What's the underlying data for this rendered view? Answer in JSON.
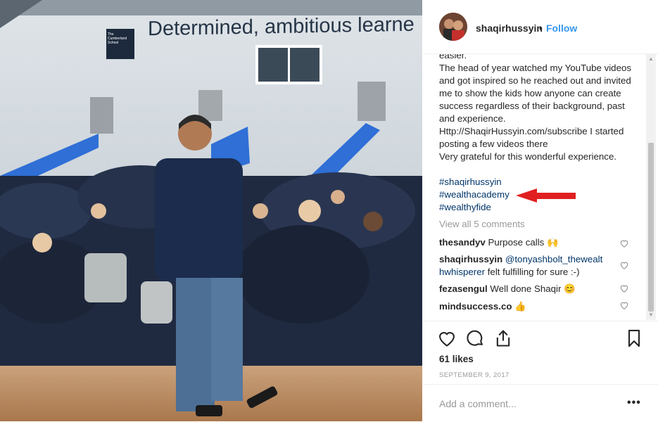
{
  "post": {
    "username": "shaqirhussyin",
    "separator": "•",
    "follow_label": "Follow",
    "photo": {
      "banner_text": "Determined, ambitious learne",
      "school_logo_text": "The Cumberland School"
    },
    "caption": "easier.\nThe head of year watched my YouTube videos and got inspired so he reached out and invited me to show the kids how anyone can create success regardless of their background, past and experience.\nHttp://ShaqirHussyin.com/subscribe I started posting a few videos there\nVery grateful for this wonderful experience.",
    "hashtags": [
      "#shaqirhussyin",
      "#wealthacademy",
      "#wealthyfide"
    ],
    "annotation_arrow_color": "#e02020",
    "view_all_comments": "View all 5 comments",
    "comments": [
      {
        "user": "thesandyv",
        "text": "Purpose calls 🙌"
      },
      {
        "user": "shaqirhussyin",
        "mention": "@tonyashbolt_thewealt hwhisperer",
        "text": " felt fulfilling for sure :-)"
      },
      {
        "user": "fezasengul",
        "text": "Well done Shaqir 😊"
      },
      {
        "user": "mindsuccess.co",
        "text": "👍"
      }
    ],
    "likes": "61 likes",
    "date": "SEPTEMBER 9, 2017",
    "add_comment_placeholder": "Add a comment...",
    "more_label": "•••",
    "colors": {
      "link": "#003569",
      "follow": "#3897f0",
      "muted": "#999999"
    }
  }
}
